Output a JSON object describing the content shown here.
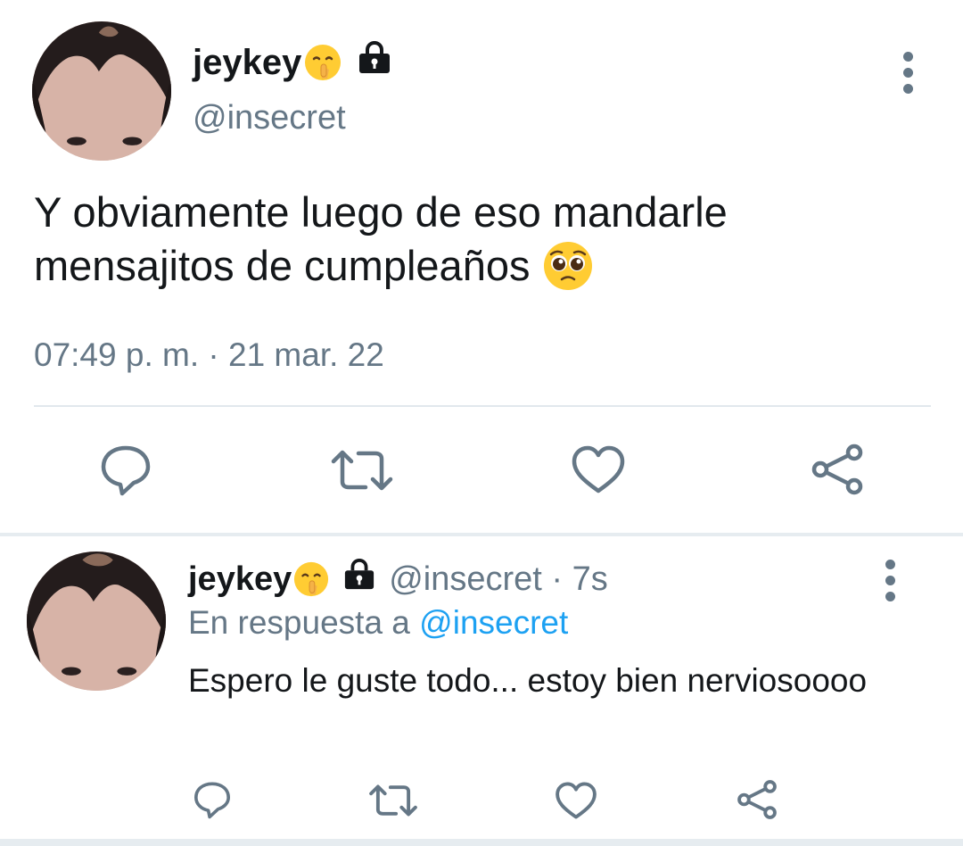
{
  "main_tweet": {
    "display_name": "jeykey",
    "handle": "@insecret",
    "text_line1": "Y obviamente luego de eso mandarle",
    "text_line2": "mensajitos de cumpleaños",
    "timestamp": "07:49 p. m. · 21 mar. 22",
    "name_emoji": "shushing-face-emoji",
    "text_emoji": "pleading-face-emoji"
  },
  "reply_tweet": {
    "display_name": "jeykey",
    "handle_time": "@insecret · 7s",
    "reply_prefix": "En respuesta a",
    "reply_mention": "@insecret",
    "text": "Espero le guste todo... estoy bien nerviosoooo",
    "name_emoji": "shushing-face-emoji"
  },
  "actions": [
    "reply-icon",
    "retweet-icon",
    "like-icon",
    "share-icon"
  ],
  "colors": {
    "text": "#14171a",
    "secondary": "#657786",
    "link": "#1da1f2",
    "divider": "#e1e8ed"
  }
}
